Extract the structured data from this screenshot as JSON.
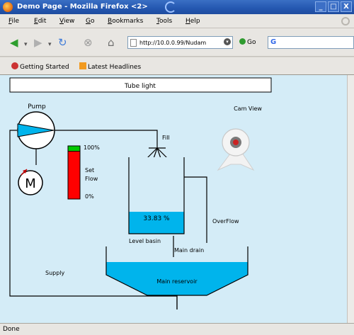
{
  "window": {
    "title": "Demo Page - Mozilla Firefox <2>",
    "minimize": "_",
    "maximize": "□",
    "close": "X"
  },
  "menu": {
    "items": [
      "File",
      "Edit",
      "View",
      "Go",
      "Bookmarks",
      "Tools",
      "Help"
    ]
  },
  "toolbar": {
    "url": "http://10.0.0.99/Nudam",
    "go_label": "Go",
    "search_value": ""
  },
  "bookmarks": {
    "items": [
      "Getting Started",
      "Latest Headlines"
    ]
  },
  "scada": {
    "tube_light_label": "Tube light",
    "pump_label": "Pump",
    "cam_view_label": "Cam View",
    "fill_label": "Fill",
    "flow_max_label": "100%",
    "set_label": "Set",
    "flow_label": "Flow",
    "flow_min_label": "0%",
    "flow_percent": 10,
    "level_value": "33.83 %",
    "level_basin_label": "Level basin",
    "overflow_label": "OverFlow",
    "main_drain_label": "Main drain",
    "supply_label": "Supply",
    "main_reservoir_label": "Main reservoir",
    "motor_label": "M",
    "colors": {
      "water": "#00b4ec",
      "flow_red": "#ff0000",
      "flow_green": "#00c800",
      "background": "#d4ecf7"
    }
  },
  "status": {
    "text": "Done"
  }
}
